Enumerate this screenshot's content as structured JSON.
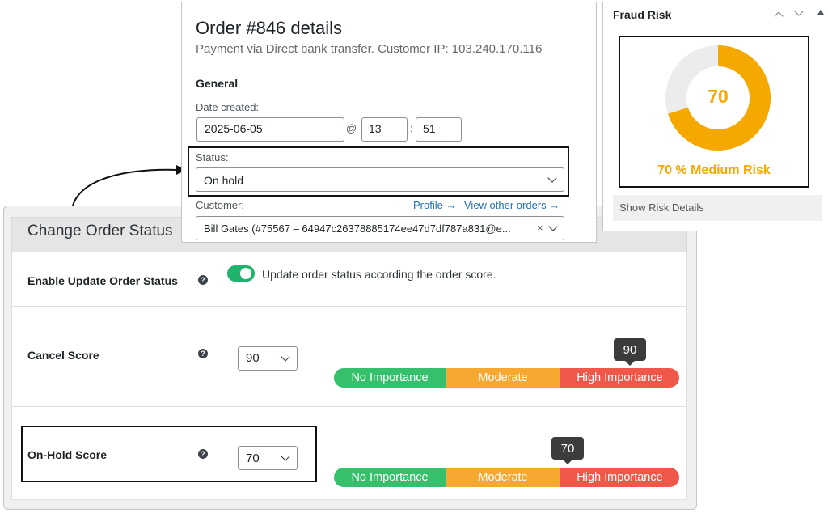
{
  "settings": {
    "title": "Change Order Status",
    "enable_row": {
      "label": "Enable Update Order Status",
      "toggle_on": true,
      "description": "Update order status according the order score."
    },
    "cancel_row": {
      "label": "Cancel Score",
      "selected_score": "90",
      "tooltip_value": "90"
    },
    "onhold_row": {
      "label": "On-Hold Score",
      "selected_score": "70",
      "tooltip_value": "70"
    },
    "score_bar": {
      "segments": [
        "No Importance",
        "Moderate",
        "High Importance"
      ]
    },
    "help_glyph": "?"
  },
  "order": {
    "title": "Order #846 details",
    "subtitle": "Payment via Direct bank transfer. Customer IP: 103.240.170.116",
    "general_heading": "General",
    "date_label": "Date created:",
    "date_value": "2025-06-05",
    "at_sign": "@",
    "hour_value": "13",
    "colon": ":",
    "minute_value": "51",
    "status_label": "Status:",
    "status_value": "On hold",
    "customer_label": "Customer:",
    "profile_link": "Profile →",
    "view_orders_link": "View other orders →",
    "customer_value": "Bill Gates (#75567 – 64947c26378885174ee47d7df787a831@e...",
    "clear_glyph": "×"
  },
  "fraud": {
    "title": "Fraud Risk",
    "score": 70,
    "score_text": "70",
    "risk_label": "70 % Medium Risk",
    "details_label": "Show Risk Details",
    "gauge_color": "#f5a800",
    "gauge_track_color": "#ececec"
  },
  "colors": {
    "toggle_on": "#1fb36b",
    "no_importance": "#36c06b",
    "moderate": "#f6a830",
    "high_importance": "#ef5849",
    "link": "#2271b1"
  }
}
